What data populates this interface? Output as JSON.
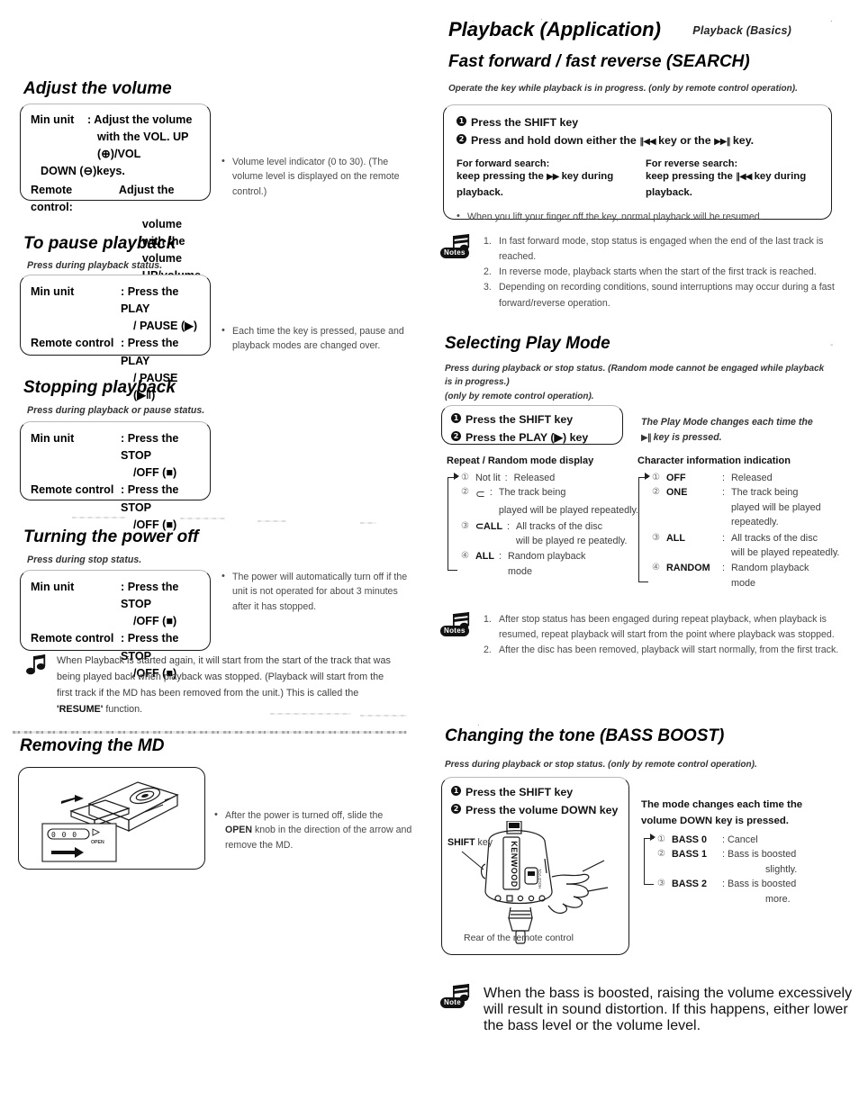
{
  "running_head": "Playback (Basics)",
  "left": {
    "volume": {
      "heading": "Adjust the volume",
      "box": {
        "row1_key": "Min unit",
        "row1_val": ": Adjust the volume",
        "row1_cont1": "with the VOL. UP (⊕)/VOL",
        "row1_cont2": "DOWN (⊖)keys.",
        "row2_key": "Remote control:",
        "row2_val": "Adjust the",
        "row2_cont1": "volume with the volume",
        "row2_cont2": "UP/volume DOWN keys."
      },
      "note": "Volume level indicator (0 to 30). (The volume level is displayed on the remote control.)"
    },
    "pause": {
      "heading": "To pause playback",
      "lead": "Press during playback status.",
      "rows": [
        {
          "key": "Min unit",
          "val": ": Press the PLAY",
          "cont": "/ PAUSE (▶)"
        },
        {
          "key": "Remote control",
          "val": ": Press the PLAY",
          "cont": "/ PAUSE (▶‖)"
        }
      ],
      "note": "Each time the key is pressed, pause and playback modes are changed over."
    },
    "stop": {
      "heading": "Stopping playback",
      "lead": "Press during playback or pause status.",
      "rows": [
        {
          "key": "Min unit",
          "val": ": Press the STOP",
          "cont": "/OFF (■)"
        },
        {
          "key": "Remote control",
          "val": ": Press the STOP",
          "cont": "/OFF (■)"
        }
      ]
    },
    "power": {
      "heading": "Turning the power off",
      "lead": "Press during stop status.",
      "rows": [
        {
          "key": "Min unit",
          "val": ": Press the STOP",
          "cont": "/OFF (■)"
        },
        {
          "key": "Remote control",
          "val": ": Press the STOP",
          "cont": "/OFF (■)"
        }
      ],
      "note": "The power will automatically turn off if the unit is not operated for about 3 minutes after it has stopped.",
      "resume_note_1": "When Playback is started again, it will start from the start of the track that was being played back when playback was stopped.  (Playback will start from the first track if the MD has been removed from the unit.)  This is called the ",
      "resume_keyword": "'RESUME'",
      "resume_note_2": " function."
    },
    "removing": {
      "heading": "Removing the MD",
      "figure": {
        "knob_label": "OPEN",
        "display_text": "0 0 : 0 0"
      },
      "note_1": "After the power is turned off, slide the ",
      "note_keyword": "OPEN",
      "note_2": " knob in the direction of the arrow and remove the MD."
    }
  },
  "right": {
    "app_title": "Playback (Application)",
    "search": {
      "heading": "Fast forward / fast reverse (SEARCH)",
      "lead": "Operate the key while playback is in progress. (only by remote control operation).",
      "step1": "Press the SHIFT key",
      "step2_a": "Press and hold down either the ",
      "step2_rew": "‖◀◀",
      "step2_b": " key or the ",
      "step2_ff": "▶▶‖",
      "step2_c": " key.",
      "forward_title": "For forward search:",
      "forward_body_a": "keep pressing the ",
      "forward_sym": "▶▶",
      "forward_body_b": " key during playback.",
      "reverse_title": "For reverse search:",
      "reverse_body_a": "keep pressing the ",
      "reverse_sym": "‖◀◀",
      "reverse_body_b": " key during playback.",
      "bullet": "When you lift your finger off the key, normal playback will be resumed.",
      "notes_label": "Notes",
      "notes": [
        "In fast forward mode, stop status is engaged when the end of the last track is reached.",
        "In reverse mode, playback starts when the start of the first track is reached.",
        "Depending on recording conditions, sound interruptions may occur during a fast forward/reverse operation."
      ]
    },
    "playmode": {
      "heading": "Selecting Play Mode",
      "lead_1": "Press during playback or stop status. (Random mode cannot be engaged while playback is in progress.)",
      "lead_2": "(only by remote control operation).",
      "step1": "Press the SHIFT key",
      "step2": "Press the PLAY (▶) key",
      "side_note_1": "The Play Mode changes each time the",
      "side_note_2_sym": "▶‖",
      "side_note_2": " key is pressed.",
      "left_table": {
        "title": "Repeat / Random mode display",
        "rows": [
          {
            "idx": "①",
            "name": "Not lit",
            "bold": false,
            "desc": "Released",
            "cont": ""
          },
          {
            "idx": "②",
            "name": "⊂",
            "bold": false,
            "desc": "The track being",
            "cont": "played will be played  repeatedly."
          },
          {
            "idx": "③",
            "name": "⊂ALL",
            "bold": true,
            "desc": "All tracks of the disc",
            "cont": "will be played re peatedly."
          },
          {
            "idx": "④",
            "name": "ALL",
            "bold": true,
            "desc": "Random playback",
            "cont": "mode"
          }
        ]
      },
      "right_table": {
        "title": "Character information indication",
        "rows": [
          {
            "idx": "①",
            "name": "OFF",
            "bold": true,
            "desc": "Released",
            "cont": ""
          },
          {
            "idx": "②",
            "name": "ONE",
            "bold": true,
            "desc": "The track being",
            "cont": "played will be played repeatedly."
          },
          {
            "idx": "③",
            "name": "ALL",
            "bold": true,
            "desc": "All tracks of the disc",
            "cont": "will be played repeatedly."
          },
          {
            "idx": "④",
            "name": "RANDOM",
            "bold": true,
            "desc": "Random playback",
            "cont": "mode"
          }
        ]
      },
      "notes_label": "Notes",
      "notes": [
        "After stop status has been engaged during repeat playback, when playback is resumed, repeat playback will start from the point where playback was stopped.",
        "After the disc has been removed, playback will start normally, from the first track."
      ]
    },
    "bass": {
      "heading": "Changing the tone (BASS BOOST)",
      "lead": "Press during playback or stop status. (only by remote control operation).",
      "step1": "Press the SHIFT key",
      "step2": "Press the volume DOWN key",
      "side_note_1": "The mode changes each time the",
      "side_note_2": "volume DOWN key is pressed.",
      "rows": [
        {
          "idx": "①",
          "name": "BASS 0",
          "desc": ": Cancel",
          "cont": ""
        },
        {
          "idx": "②",
          "name": "BASS 1",
          "desc": ": Bass is boosted",
          "cont": "slightly."
        },
        {
          "idx": "③",
          "name": "BASS 2",
          "desc": ": Bass is boosted",
          "cont": "more."
        }
      ],
      "figure": {
        "shift_label_bold": "SHIFT",
        "shift_label_rest": " key",
        "brand": "KENWOOD",
        "caption": "Rear of the remote control"
      },
      "note_label": "Note",
      "note": "When the bass is boosted, raising the volume excessively will result in sound distortion.  If this happens, either lower the bass level or the volume level."
    }
  }
}
